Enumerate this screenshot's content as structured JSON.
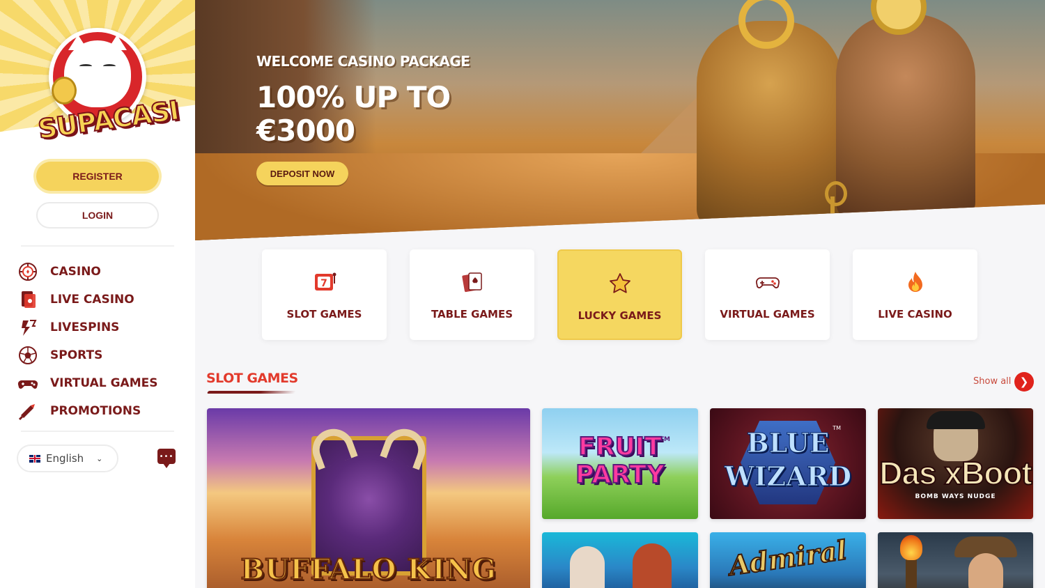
{
  "brand": {
    "name": "SUPACASI"
  },
  "auth": {
    "register_label": "REGISTER",
    "login_label": "LOGIN"
  },
  "nav": {
    "items": [
      {
        "label": "CASINO",
        "icon": "casino-chip-icon"
      },
      {
        "label": "LIVE CASINO",
        "icon": "playing-card-icon"
      },
      {
        "label": "LIVESPINS",
        "icon": "lightning-icon"
      },
      {
        "label": "SPORTS",
        "icon": "soccer-ball-icon"
      },
      {
        "label": "VIRTUAL GAMES",
        "icon": "gamepad-icon"
      },
      {
        "label": "PROMOTIONS",
        "icon": "megaphone-icon"
      }
    ]
  },
  "language": {
    "selected": "English",
    "flag": "uk-flag-icon"
  },
  "chat": {
    "icon": "chat-bubble-icon"
  },
  "hero": {
    "kicker": "WELCOME CASINO PACKAGE",
    "headline": "100% UP TO €3000",
    "cta_label": "DEPOSIT NOW"
  },
  "categories": [
    {
      "label": "SLOT GAMES",
      "icon": "slot-777-icon",
      "active": false
    },
    {
      "label": "TABLE GAMES",
      "icon": "cards-icon",
      "active": false
    },
    {
      "label": "LUCKY GAMES",
      "icon": "star-icon",
      "active": true
    },
    {
      "label": "VIRTUAL GAMES",
      "icon": "gamepad-icon",
      "active": false
    },
    {
      "label": "LIVE CASINO",
      "icon": "flame-icon",
      "active": false
    }
  ],
  "slot_section": {
    "title": "SLOT GAMES",
    "show_all_label": "Show all",
    "games": [
      {
        "title": "BUFFALO KING"
      },
      {
        "title": "FRUIT PARTY",
        "mark": "TM"
      },
      {
        "title": "BLUE WIZARD",
        "mark": "TM"
      },
      {
        "title": "Das xBoot",
        "subtitle": "BOMB WAYS NUDGE"
      },
      {
        "title": ""
      },
      {
        "title": "Admiral"
      },
      {
        "title": ""
      }
    ]
  },
  "colors": {
    "accent_yellow": "#f5d35c",
    "brand_maroon": "#7a1a1a",
    "section_red": "#e23a2c",
    "button_red": "#e0231c"
  }
}
